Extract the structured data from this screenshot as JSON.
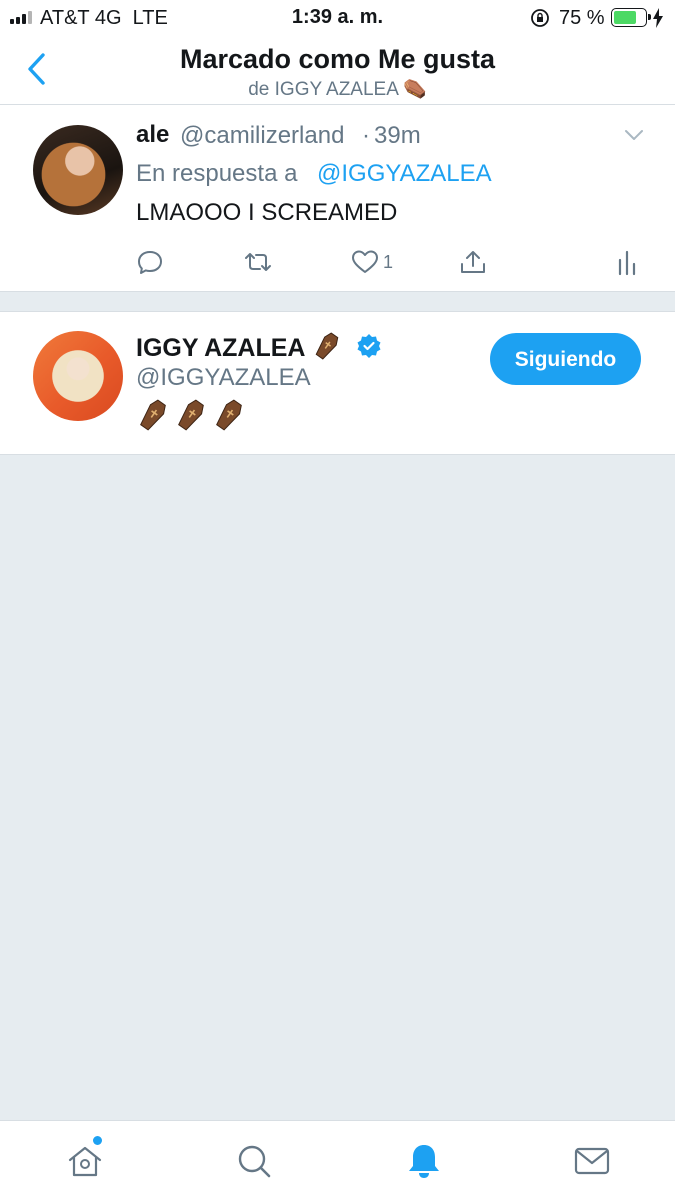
{
  "status_bar": {
    "carrier": "AT&T 4G",
    "network": "LTE",
    "time": "1:39 a. m.",
    "battery_percent": "75 %",
    "battery_level": 0.75,
    "signal_bars": 3
  },
  "header": {
    "title": "Marcado como Me gusta",
    "subtitle": "de IGGY AZALEA ⚰️",
    "back_icon": "chevron-left-icon"
  },
  "tweet": {
    "display_name": "ale",
    "handle": "@camilizerland",
    "separator": "·",
    "time": "39m",
    "reply_label": "En respuesta a",
    "reply_handle": "@IGGYAZALEA",
    "text": "LMAOOO I SCREAMED",
    "like_count": "1",
    "actions": [
      "reply-icon",
      "retweet-icon",
      "like-icon",
      "share-icon",
      "analytics-icon"
    ]
  },
  "user": {
    "display_name": "IGGY AZALEA",
    "verified": true,
    "handle": "@IGGYAZALEA",
    "bio": "⚰️⚰️⚰️",
    "follow_label": "Siguiendo"
  },
  "tabbar": {
    "tabs": [
      "home-icon",
      "search-icon",
      "notifications-icon",
      "messages-icon"
    ],
    "active": "notifications-icon"
  },
  "colors": {
    "accent": "#1da1f2",
    "text": "#14171a",
    "secondary": "#657786",
    "background": "#e6ecf0",
    "battery": "#4cd964"
  }
}
